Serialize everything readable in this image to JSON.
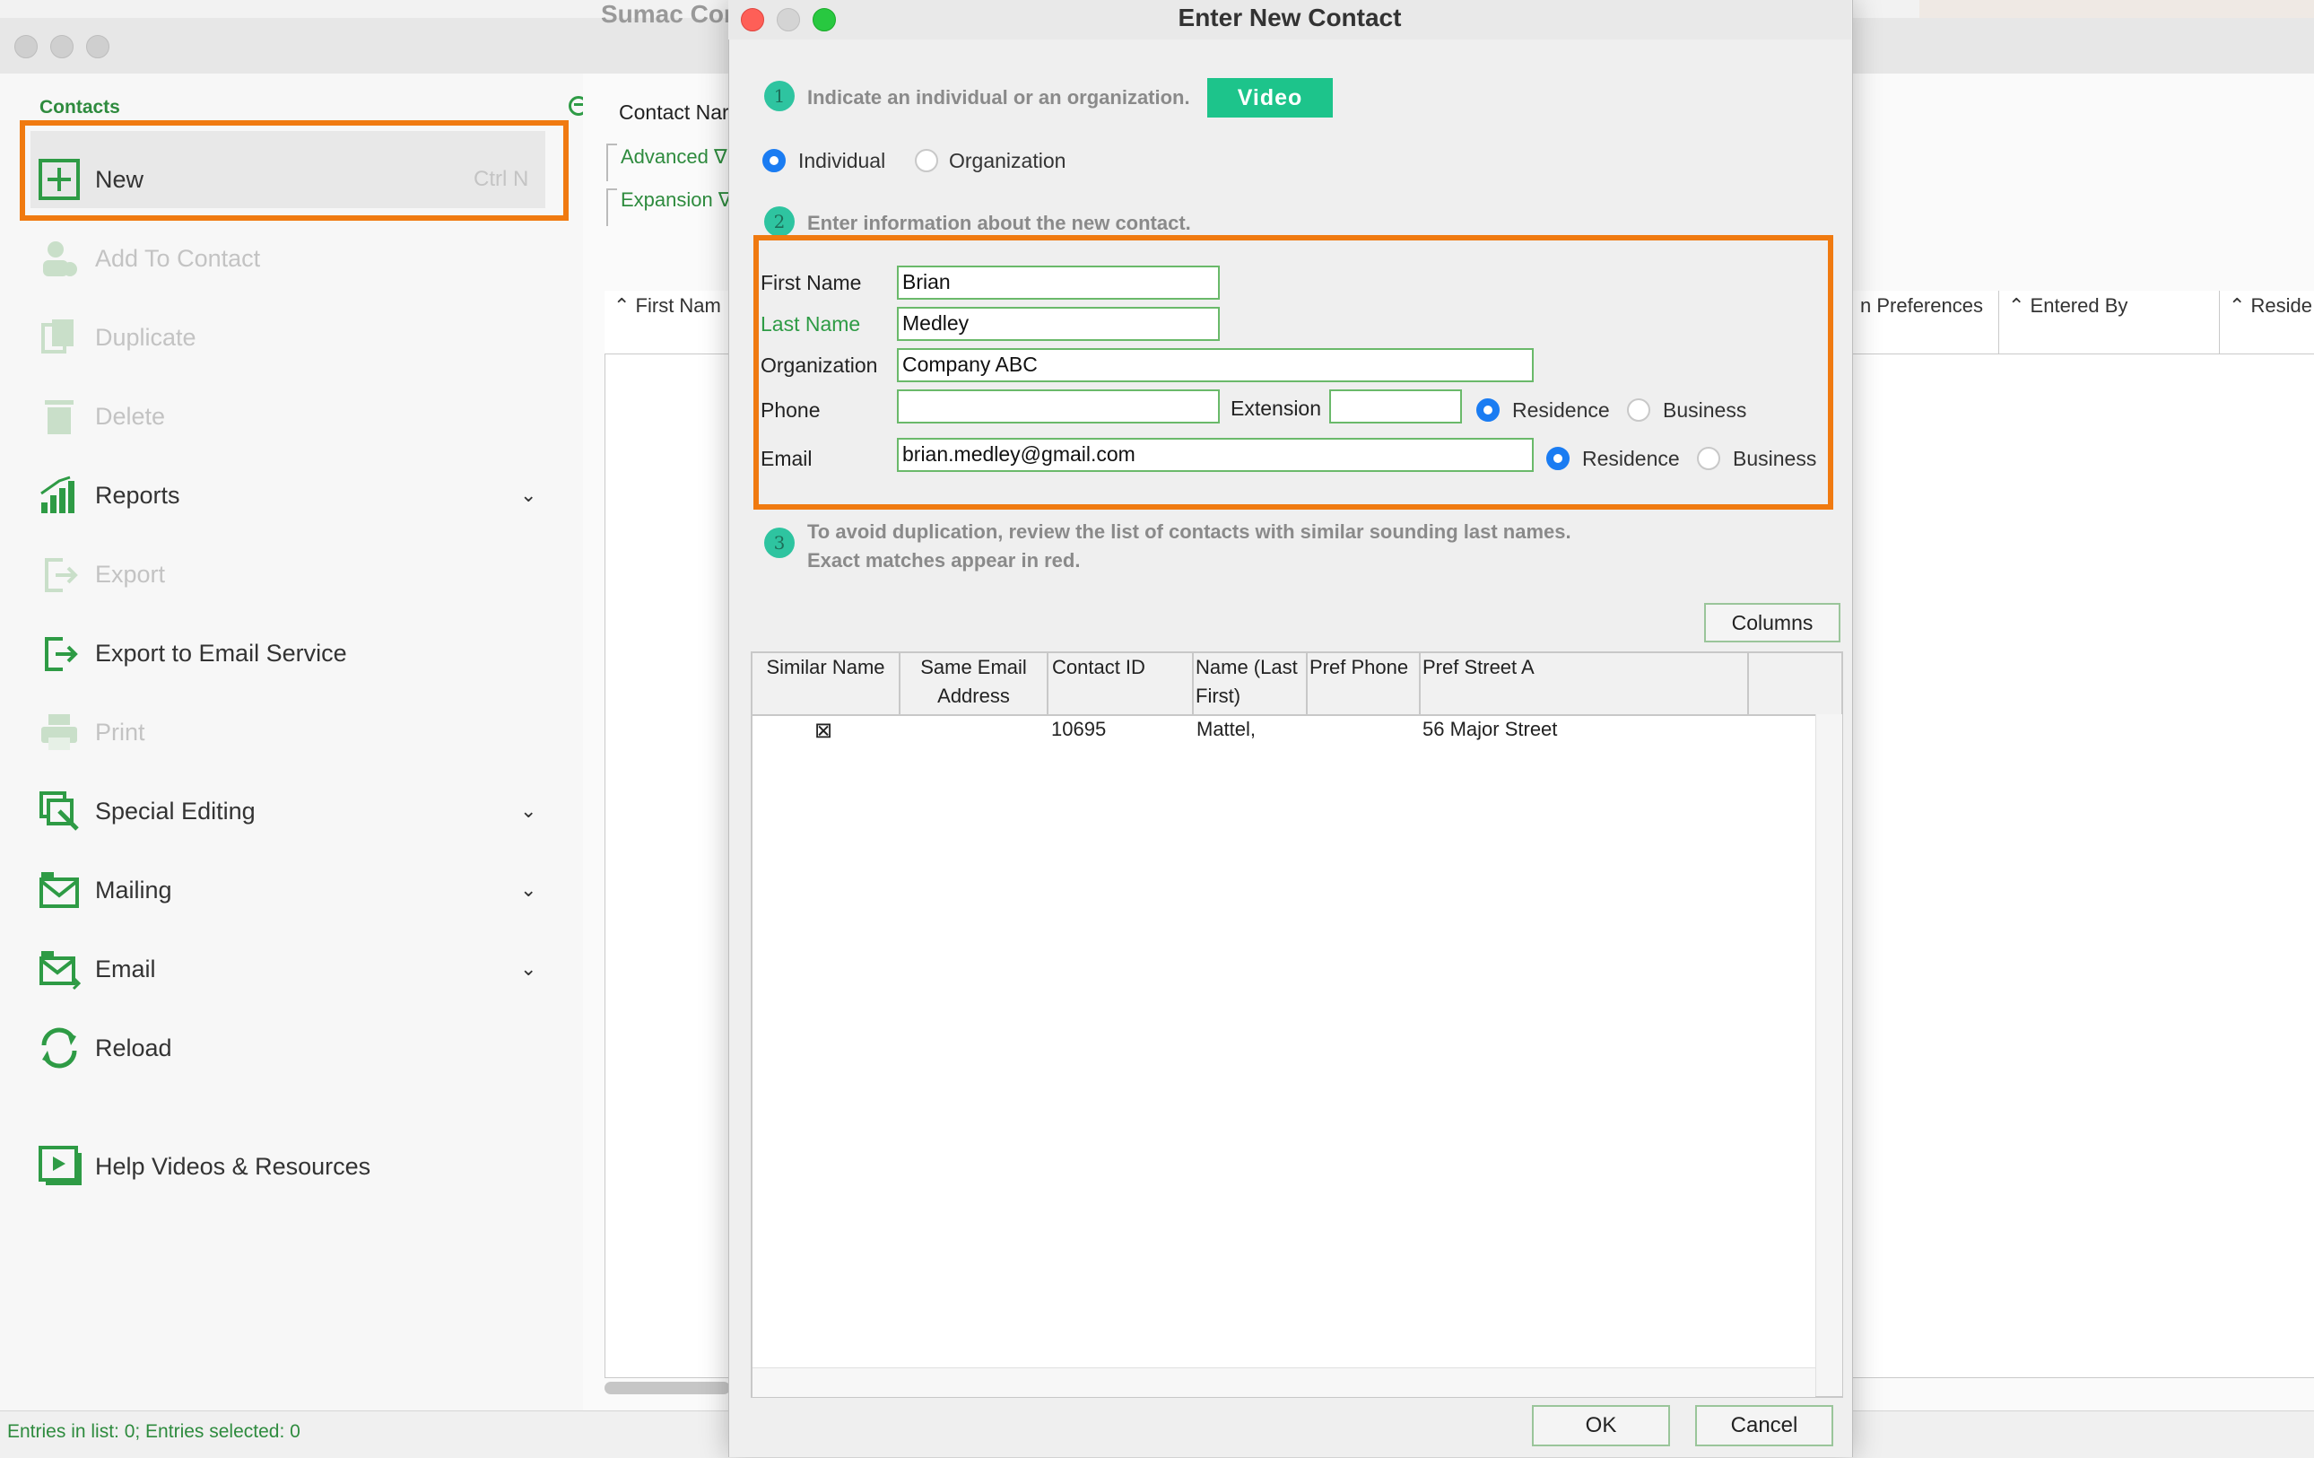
{
  "main_window": {
    "title": "Sumac Con",
    "sidebar": {
      "section_label": "Contacts",
      "new_item": {
        "label": "New",
        "shortcut": "Ctrl N"
      },
      "items": [
        {
          "label": "Add To Contact",
          "enabled": false
        },
        {
          "label": "Duplicate",
          "enabled": false
        },
        {
          "label": "Delete",
          "enabled": false
        },
        {
          "label": "Reports",
          "enabled": true,
          "expandable": true
        },
        {
          "label": "Export",
          "enabled": false
        },
        {
          "label": "Export to Email Service",
          "enabled": true
        },
        {
          "label": "Print",
          "enabled": false
        },
        {
          "label": "Special Editing",
          "enabled": true,
          "expandable": true
        },
        {
          "label": "Mailing",
          "enabled": true,
          "expandable": true
        },
        {
          "label": "Email",
          "enabled": true,
          "expandable": true
        },
        {
          "label": "Reload",
          "enabled": true
        },
        {
          "label": "Help Videos & Resources",
          "enabled": true
        }
      ]
    },
    "filters": {
      "contact_name_label": "Contact Nar",
      "advanced_label": "Advanced ∇",
      "expansion_label": "Expansion ∇"
    },
    "table_columns": [
      "First Nam",
      "n Preferences",
      "Entered By",
      "Reside"
    ],
    "status": "Entries in list: 0; Entries selected: 0"
  },
  "dialog": {
    "title": "Enter New Contact",
    "step1": {
      "number": "1",
      "text": "Indicate an individual or an organization.",
      "video_button": "Video"
    },
    "contact_type": {
      "options": [
        "Individual",
        "Organization"
      ],
      "selected": "Individual"
    },
    "step2": {
      "number": "2",
      "text": "Enter information about the new contact."
    },
    "form": {
      "first_name": {
        "label": "First Name",
        "value": "Brian"
      },
      "last_name": {
        "label": "Last Name",
        "value": "Medley"
      },
      "organization": {
        "label": "Organization",
        "value": "Company ABC"
      },
      "phone": {
        "label": "Phone",
        "value": "",
        "extension_label": "Extension",
        "extension_value": "",
        "types": [
          "Residence",
          "Business"
        ],
        "selected": "Residence"
      },
      "email": {
        "label": "Email",
        "value": "brian.medley@gmail.com",
        "types": [
          "Residence",
          "Business"
        ],
        "selected": "Residence"
      }
    },
    "step3": {
      "number": "3",
      "text_line1": "To avoid duplication, review the list of contacts with similar sounding last names.",
      "text_line2": "Exact matches appear in red."
    },
    "columns_button": "Columns",
    "similar_table": {
      "headers": [
        "Similar Name",
        "Same Email Address",
        "Contact ID",
        "Name (Last First)",
        "Pref Phone",
        "Pref Street A"
      ],
      "header_lines": {
        "similar_name": "Similar Name",
        "same_email_1": "Same Email",
        "same_email_2": "Address",
        "contact_id": "Contact ID",
        "name_1": "Name (Last",
        "name_2": "First)",
        "pref_phone": "Pref Phone",
        "pref_street": "Pref Street A"
      },
      "rows": [
        {
          "similar_name": "⊠",
          "same_email": "",
          "contact_id": "10695",
          "name": "Mattel,",
          "pref_phone": "",
          "pref_street": "56 Major Street"
        }
      ]
    },
    "ok_button": "OK",
    "cancel_button": "Cancel"
  },
  "colors": {
    "accent_green": "#2e8b3e",
    "highlight_orange": "#f07a10",
    "video_button": "#1dc48b",
    "radio_selected": "#1a7cf2"
  }
}
